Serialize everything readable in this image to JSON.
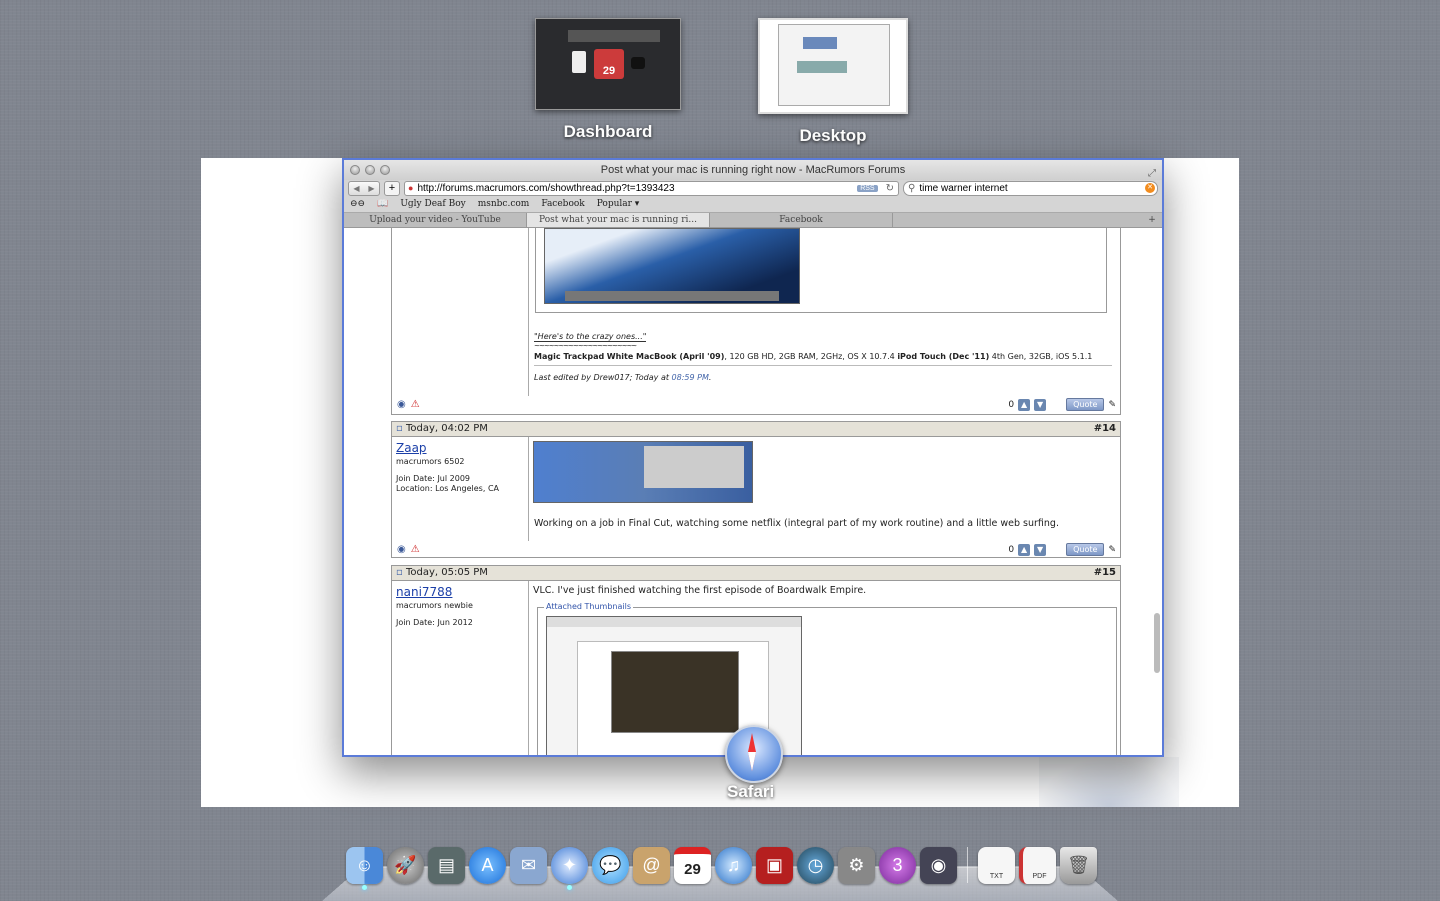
{
  "spaces": [
    {
      "label": "Dashboard",
      "date": "29"
    },
    {
      "label": "Desktop"
    }
  ],
  "app_label": "Safari",
  "window": {
    "title": "Post what your mac is running right now - MacRumors Forums",
    "url": "http://forums.macrumors.com/showthread.php?t=1393423",
    "rss": "RSS",
    "search": "time warner internet",
    "bookmarks": [
      "Ugly Deaf Boy",
      "msnbc.com",
      "Facebook",
      "Popular ▾"
    ],
    "tabs": [
      "Upload your video - YouTube",
      "Post what your mac is running ri...",
      "Facebook"
    ]
  },
  "posts": {
    "p13": {
      "sig_line1": "\"Here's to the crazy ones...\"",
      "sig_line2": "~~~~~~~~~~~~~~~~~~~~~",
      "sig_bold1": "Magic Trackpad",
      "sig_bold2": "White MacBook (April '09)",
      "sig_specs": ", 120 GB HD, 2GB RAM, 2GHz, OS X 10.7.4",
      "sig_bold3": "iPod Touch (Dec '11)",
      "sig_specs2": " 4th Gen, 32GB, iOS 5.1.1",
      "edited": "Last edited by Drew017; Today at ",
      "edited_time": "08:59 PM",
      "edited_end": ".",
      "score": "0",
      "quote": "Quote"
    },
    "p14": {
      "date": "Today, 04:02 PM",
      "num": "#14",
      "user": "Zaap",
      "title": "macrumors 6502",
      "join": "Join Date: Jul 2009",
      "location": "Location: Los Angeles, CA",
      "text": "Working on a job in Final Cut, watching some netflix (integral part of my work routine) and a little web surfing.",
      "score": "0",
      "quote": "Quote"
    },
    "p15": {
      "date": "Today, 05:05 PM",
      "num": "#15",
      "user": "nani7788",
      "title": "macrumors newbie",
      "join": "Join Date: Jun 2012",
      "text": "VLC. I've just finished watching the first episode of Boardwalk Empire.",
      "attached": "Attached Thumbnails"
    }
  },
  "dock": {
    "items": [
      "finder",
      "launchpad",
      "iphoto",
      "app-store",
      "mail",
      "safari",
      "messages",
      "contacts",
      "calendar",
      "itunes",
      "photo-booth",
      "time-machine",
      "system-preferences",
      "istat",
      "facetime",
      "txt-document",
      "pdf-document",
      "trash"
    ],
    "calendar_date": "29",
    "txt_label": "TXT",
    "pdf_label": "PDF"
  }
}
